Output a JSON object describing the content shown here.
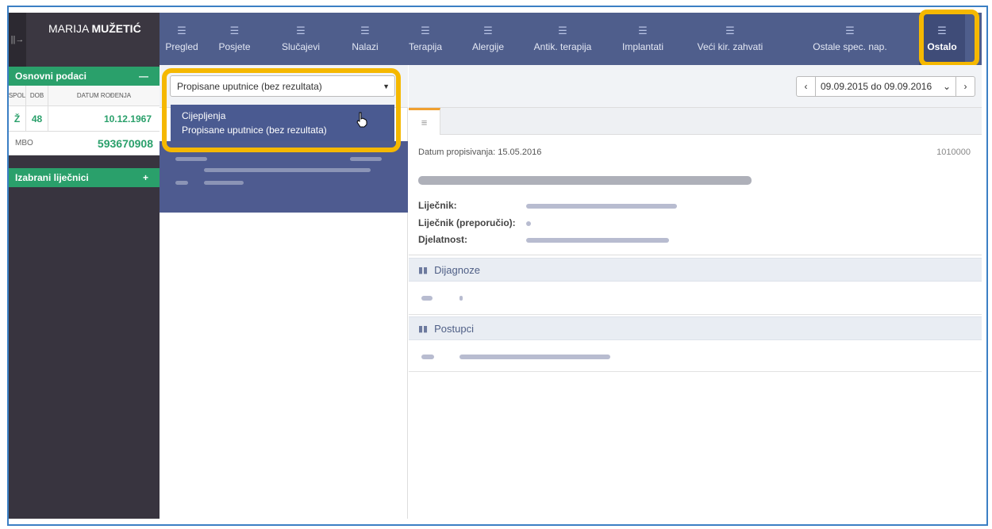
{
  "patient": {
    "first_name": "MARIJA",
    "last_name": "MUŽETIĆ"
  },
  "sidebar": {
    "handle_icon": "||→",
    "basic_section": {
      "title": "Osnovni podaci",
      "toggle": "—"
    },
    "columns": [
      "SPOL",
      "DOB",
      "DATUM ROĐENJA"
    ],
    "values": [
      "Ž",
      "48",
      "10.12.1967"
    ],
    "mbo_label": "MBO",
    "mbo_value": "593670908",
    "doctors_section": {
      "title": "Izabrani liječnici",
      "toggle": "+"
    }
  },
  "nav": {
    "items": [
      {
        "label": "Pregled",
        "icon": "list-icon"
      },
      {
        "label": "Posjete",
        "icon": "list-icon"
      },
      {
        "label": "Slučajevi",
        "icon": "list-icon"
      },
      {
        "label": "Nalazi",
        "icon": "list-icon"
      },
      {
        "label": "Terapija",
        "icon": "list-icon"
      },
      {
        "label": "Alergije",
        "icon": "list-icon"
      },
      {
        "label": "Antik. terapija",
        "icon": "list-icon"
      },
      {
        "label": "Implantati",
        "icon": "list-icon"
      },
      {
        "label": "Veći kir. zahvati",
        "icon": "list-icon"
      },
      {
        "label": "Ostale spec. nap.",
        "icon": "list-icon"
      },
      {
        "label": "Ostalo",
        "icon": "list-icon"
      }
    ],
    "active_index": 10
  },
  "filter": {
    "selected": "Propisane uputnice (bez rezultata)",
    "options": [
      "Cijepljenja",
      "Propisane uputnice (bez rezultata)"
    ]
  },
  "date_range": {
    "label": "09.09.2015 do 09.09.2016",
    "prev": "‹",
    "next": "›",
    "caret": "⌄"
  },
  "detail": {
    "date_line": "Datum propisivanja: 15.05.2016",
    "code": "1010000",
    "fields": [
      "Liječnik:",
      "Liječnik (preporučio):",
      "Djelatnost:"
    ]
  },
  "sections": {
    "diagnoses": "Dijagnoze",
    "procedures": "Postupci"
  },
  "colors": {
    "nav_bg": "#4f5e8c",
    "green": "#2aa06b",
    "highlight": "#f5b800",
    "sidebar_bg": "#38343f"
  }
}
